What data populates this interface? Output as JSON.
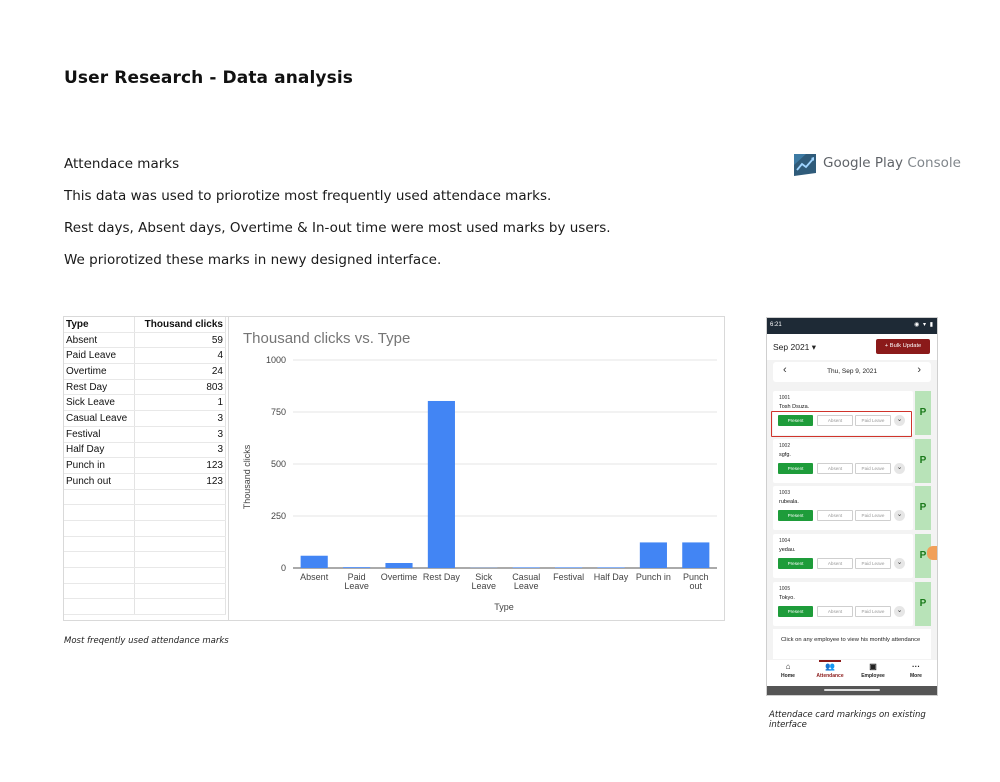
{
  "page": {
    "title": "User Research - Data analysis",
    "section_heading": "Attendace marks",
    "paragraphs": [
      "This data was used to priorotize most frequently used attendace marks.",
      "Rest days, Absent days, Overtime & In-out time were most used marks by users.",
      "We priorotized these marks in newy designed interface."
    ],
    "logo_text_strong": "Google Play",
    "logo_text_light": " Console",
    "caption_chart": "Most freqently used attendance marks",
    "caption_phone": "Attendace card markings on existing interface"
  },
  "table": {
    "headers": [
      "Type",
      "Thousand clicks"
    ],
    "rows": [
      [
        "Absent",
        "59"
      ],
      [
        "Paid Leave",
        "4"
      ],
      [
        "Overtime",
        "24"
      ],
      [
        "Rest Day",
        "803"
      ],
      [
        "Sick Leave",
        "1"
      ],
      [
        "Casual Leave",
        "3"
      ],
      [
        "Festival",
        "3"
      ],
      [
        "Half Day",
        "3"
      ],
      [
        "Punch in",
        "123"
      ],
      [
        "Punch out",
        "123"
      ]
    ]
  },
  "chart_data": {
    "type": "bar",
    "title": "Thousand clicks vs. Type",
    "xlabel": "Type",
    "ylabel": "Thousand clicks",
    "categories": [
      "Absent",
      "Paid Leave",
      "Overtime",
      "Rest Day",
      "Sick Leave",
      "Casual Leave",
      "Festival",
      "Half Day",
      "Punch in",
      "Punch out"
    ],
    "values": [
      59,
      4,
      24,
      803,
      1,
      3,
      3,
      3,
      123,
      123
    ],
    "ylim": [
      0,
      1000
    ],
    "yticks": [
      0,
      250,
      500,
      750,
      1000
    ],
    "grid": true,
    "bar_color": "#4285f4"
  },
  "phone": {
    "time": "6:21",
    "month": "Sep 2021",
    "bulk_label": "+ Bulk Update",
    "date": "Thu, Sep 9, 2021",
    "cards": [
      {
        "id": "1001",
        "name": "Tosh Dsuza.",
        "present": "Present",
        "absent": "Absent",
        "paid": "Paid Leave",
        "mark": "P"
      },
      {
        "id": "1002",
        "name": "sgfg.",
        "present": "Present",
        "absent": "Absent",
        "paid": "Paid Leave",
        "mark": "P"
      },
      {
        "id": "1003",
        "name": "rubeala.",
        "present": "Present",
        "absent": "Absent",
        "paid": "Paid Leave",
        "mark": "P"
      },
      {
        "id": "1004",
        "name": "yedau.",
        "present": "Present",
        "absent": "Absent",
        "paid": "Paid Leave",
        "mark": "P"
      },
      {
        "id": "1005",
        "name": "Tokyo.",
        "present": "Present",
        "absent": "Absent",
        "paid": "Paid Leave",
        "mark": "P"
      }
    ],
    "notice": "Click on any employee to view his monthly attendance",
    "nav": [
      "Home",
      "Attendance",
      "Employee",
      "More"
    ],
    "accent": "#8b1a1a",
    "present_color": "#1e9c3a"
  }
}
